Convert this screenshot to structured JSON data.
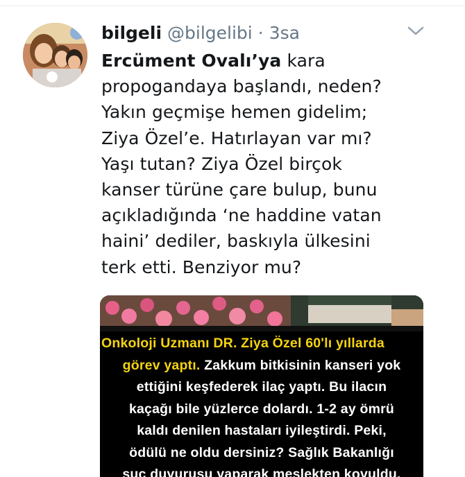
{
  "tweet": {
    "display_name": "bilgeli",
    "handle": "@bilgelibi",
    "separator": "·",
    "time": "3sa",
    "avatar_icon": "profile-photo-children",
    "caret_icon": "chevron-down-icon",
    "text_lines": [
      {
        "bold": "Ercüment Ovalı’ya",
        "rest": " kara"
      },
      {
        "bold": "",
        "rest": "propogandaya başlandı, neden?"
      },
      {
        "bold": "",
        "rest": "Yakın geçmişe hemen gidelim;"
      },
      {
        "bold": "",
        "rest": "Ziya Özel’e. Hatırlayan var mı?"
      },
      {
        "bold": "",
        "rest": "Yaşı tutan? Ziya Özel birçok"
      },
      {
        "bold": "",
        "rest": "kanser türüne çare bulup, bunu"
      },
      {
        "bold": "",
        "rest": "açıkladığında ‘ne haddine vatan"
      },
      {
        "bold": "",
        "rest": "haini’ dediler, baskıyla ülkesini"
      },
      {
        "bold": "",
        "rest": "terk etti. Benziyor mu?"
      }
    ]
  },
  "media": {
    "caption_lines": [
      {
        "highlight": "Onkoloji Uzmanı DR. Ziya Özel 60'lı yıllarda",
        "rest": ""
      },
      {
        "highlight": "görev yaptı.",
        "rest": " Zakkum bitkisinin kanseri yok"
      },
      {
        "highlight": "",
        "rest": "ettiğini keşfederek ilaç yaptı. Bu ilacın"
      },
      {
        "highlight": "",
        "rest": "kaçağı bile yüzlerce dolardı. 1-2 ay ömrü"
      },
      {
        "highlight": "",
        "rest": "kaldı denilen hastaları iyileştirdi. Peki,"
      },
      {
        "highlight": "",
        "rest": "ödülü ne oldu dersiniz? Sağlık Bakanlığı"
      },
      {
        "highlight": "",
        "rest": "suç duyurusu yaparak meslekten kovuldu."
      }
    ],
    "colors": {
      "highlight": "#f5d312",
      "text": "#ffffff",
      "background": "#000000"
    }
  },
  "colors": {
    "name": "#14171a",
    "meta": "#657786",
    "text": "#14171a"
  }
}
